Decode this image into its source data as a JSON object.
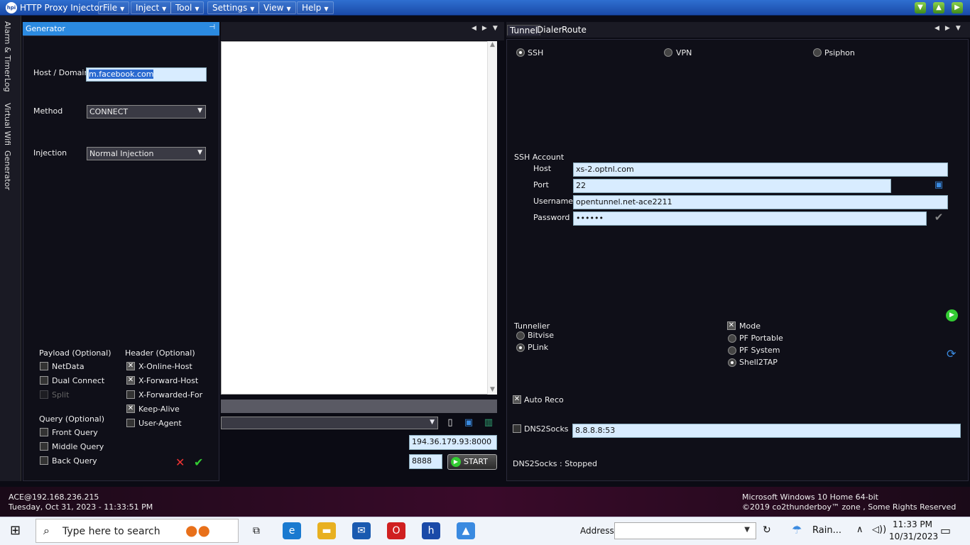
{
  "app": {
    "title": "HTTP Proxy Injector",
    "logo_text": "hpi",
    "menus": [
      "File",
      "Inject",
      "Tool",
      "Settings",
      "View",
      "Help"
    ]
  },
  "side_tabs": [
    "Alarm & Timer",
    "Log",
    "Virtual Wifi",
    "Generator"
  ],
  "generator": {
    "header": "Generator",
    "host_label": "Host / Domain",
    "host_value": "m.facebook.com",
    "method_label": "Method",
    "method_value": "CONNECT",
    "injection_label": "Injection",
    "injection_value": "Normal Injection",
    "payload": {
      "title": "Payload (Optional)",
      "items": [
        {
          "label": "NetData",
          "checked": false
        },
        {
          "label": "Dual Connect",
          "checked": false
        },
        {
          "label": "Split",
          "checked": false,
          "disabled": true
        }
      ]
    },
    "header_opt": {
      "title": "Header (Optional)",
      "items": [
        {
          "label": "X-Online-Host",
          "checked": true
        },
        {
          "label": "X-Forward-Host",
          "checked": true
        },
        {
          "label": "X-Forwarded-For",
          "checked": false
        },
        {
          "label": "Keep-Alive",
          "checked": true
        },
        {
          "label": "User-Agent",
          "checked": false
        }
      ]
    },
    "query": {
      "title": "Query (Optional)",
      "items": [
        {
          "label": "Front Query",
          "checked": false
        },
        {
          "label": "Middle Query",
          "checked": false
        },
        {
          "label": "Back Query",
          "checked": false
        }
      ]
    }
  },
  "middle": {
    "proxy": "194.36.179.93:8000",
    "local_port": "8888",
    "start_label": "START"
  },
  "tunnel": {
    "tabs": [
      "Tunnel",
      "Dialer",
      "Route"
    ],
    "modes": [
      {
        "label": "SSH",
        "selected": true
      },
      {
        "label": "VPN",
        "selected": false
      },
      {
        "label": "Psiphon",
        "selected": false
      }
    ],
    "ssh_account_title": "SSH Account",
    "host_label": "Host",
    "host_value": "xs-2.optnl.com",
    "port_label": "Port",
    "port_value": "22",
    "username_label": "Username",
    "username_value": "opentunnel.net-ace2211",
    "password_label": "Password",
    "password_value": "••••••",
    "tunnelier_title": "Tunnelier",
    "tunnelier_options": [
      {
        "label": "Bitvise",
        "selected": false
      },
      {
        "label": "PLink",
        "selected": true
      }
    ],
    "mode_label": "Mode",
    "mode_checked": true,
    "mode_options": [
      {
        "label": "PF Portable",
        "selected": false
      },
      {
        "label": "PF System",
        "selected": false
      },
      {
        "label": "Shell2TAP",
        "selected": true
      }
    ],
    "auto_reco_label": "Auto Reco",
    "auto_reco_checked": true,
    "dns2socks_label": "DNS2Socks",
    "dns2socks_checked": false,
    "dns2socks_value": "8.8.8.8:53",
    "dns2socks_status": "DNS2Socks : Stopped"
  },
  "footer": {
    "user": "ACE@192.168.236.215",
    "datetime": "Tuesday, Oct 31, 2023 - 11:33:51 PM",
    "os": "Microsoft Windows 10 Home 64-bit",
    "copyright": "©2019 co2thunderboy™ zone , Some Rights Reserved"
  },
  "taskbar": {
    "search_placeholder": "Type here to search",
    "address_label": "Address",
    "weather": "Rain...",
    "time": "11:33 PM",
    "date": "10/31/2023"
  }
}
